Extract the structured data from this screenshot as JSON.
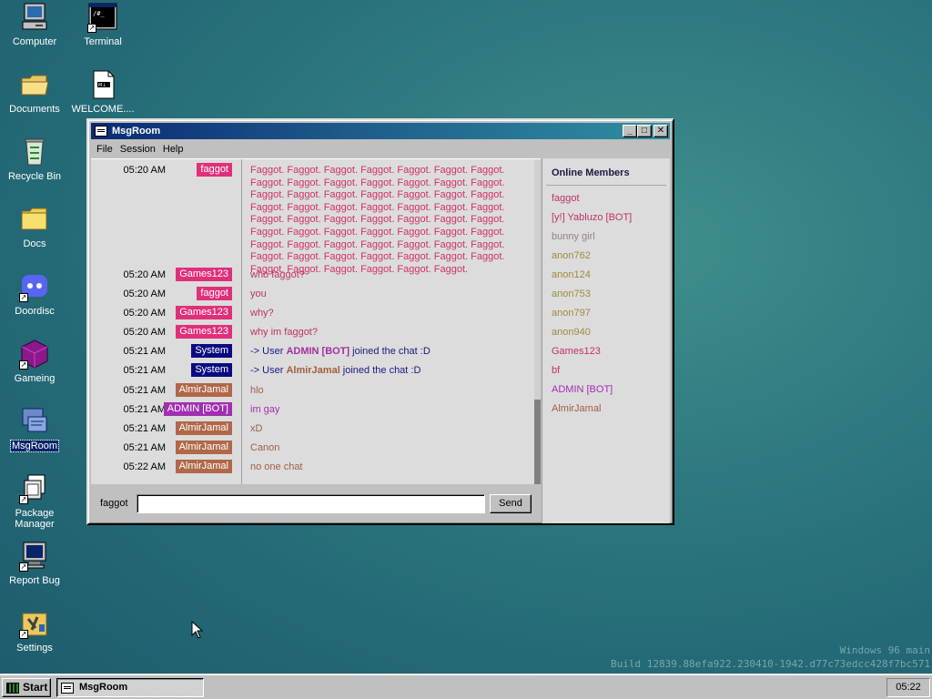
{
  "desktop": {
    "icons": [
      {
        "label": "Computer",
        "icon": "computer-icon"
      },
      {
        "label": "Terminal",
        "icon": "terminal-icon"
      },
      {
        "label": "Documents",
        "icon": "folder-open-icon"
      },
      {
        "label": "WELCOME....",
        "icon": "document-icon"
      },
      {
        "label": "Recycle Bin",
        "icon": "recycle-bin-icon"
      },
      {
        "label": "Docs",
        "icon": "folder-icon"
      },
      {
        "label": "Doordisc",
        "icon": "doordisc-icon"
      },
      {
        "label": "Gameing",
        "icon": "cube-icon"
      },
      {
        "label": "MsgRoom",
        "icon": "msgroom-icon"
      },
      {
        "label": "Package Manager",
        "icon": "package-icon"
      },
      {
        "label": "Report Bug",
        "icon": "monitor-icon"
      },
      {
        "label": "Settings",
        "icon": "settings-icon"
      }
    ],
    "watermark_line1": "Windows 96 main",
    "watermark_line2": "Build 12839.88efa922.230410-1942.d77c73edcc428f7bc571"
  },
  "window": {
    "title": "MsgRoom",
    "menu": [
      "File",
      "Session",
      "Help"
    ],
    "messages": [
      {
        "time": "05:20 AM",
        "nick": "faggot",
        "nick_color": "#e0307a",
        "text": "Faggot. Faggot. Faggot. Faggot. Faggot. Faggot. Faggot. Faggot. Faggot. Faggot. Faggot. Faggot. Faggot. Faggot. Faggot. Faggot. Faggot. Faggot. Faggot. Faggot. Faggot. Faggot. Faggot. Faggot. Faggot. Faggot. Faggot. Faggot. Faggot. Faggot. Faggot. Faggot. Faggot. Faggot. Faggot. Faggot. Faggot. Faggot. Faggot. Faggot. Faggot. Faggot. Faggot. Faggot. Faggot. Faggot. Faggot. Faggot. Faggot. Faggot. Faggot. Faggot. Faggot. Faggot. Faggot. Faggot. Faggot. Faggot. Faggot. Faggot. Faggot. Faggot.",
        "text_color": "#d0306a"
      },
      {
        "time": "05:20 AM",
        "nick": "Games123",
        "nick_color": "#e0307a",
        "text": "who faggot?",
        "text_color": "#c0306a"
      },
      {
        "time": "05:20 AM",
        "nick": "faggot",
        "nick_color": "#e0307a",
        "text": "you",
        "text_color": "#c0306a"
      },
      {
        "time": "05:20 AM",
        "nick": "Games123",
        "nick_color": "#e0307a",
        "text": "why?",
        "text_color": "#c0306a"
      },
      {
        "time": "05:20 AM",
        "nick": "Games123",
        "nick_color": "#e0307a",
        "text": "why im faggot?",
        "text_color": "#c0306a"
      },
      {
        "time": "05:21 AM",
        "nick": "System",
        "nick_color": "#0a0a80",
        "system": true,
        "prefix": "-> User ",
        "user": "ADMIN [BOT]",
        "user_color": "#a030a0",
        "suffix": " joined the chat :D",
        "text_color": "#1a1a80"
      },
      {
        "time": "05:21 AM",
        "nick": "System",
        "nick_color": "#0a0a80",
        "system": true,
        "prefix": "-> User ",
        "user": "AlmirJamal",
        "user_color": "#a06040",
        "suffix": " joined the chat :D",
        "text_color": "#1a1a80"
      },
      {
        "time": "05:21 AM",
        "nick": "AlmirJamal",
        "nick_color": "#b06848",
        "text": "hlo",
        "text_color": "#a06048"
      },
      {
        "time": "05:21 AM",
        "nick": "ADMIN [BOT]",
        "nick_color": "#a030b0",
        "text": "im gay",
        "text_color": "#a030b0"
      },
      {
        "time": "05:21 AM",
        "nick": "AlmirJamal",
        "nick_color": "#b06848",
        "text": "xD",
        "text_color": "#a06048"
      },
      {
        "time": "05:21 AM",
        "nick": "AlmirJamal",
        "nick_color": "#b06848",
        "text": "Canon",
        "text_color": "#a06048"
      },
      {
        "time": "05:22 AM",
        "nick": "AlmirJamal",
        "nick_color": "#b06848",
        "text": "no one chat",
        "text_color": "#a06048"
      }
    ],
    "input": {
      "nick_label": "faggot",
      "value": "",
      "send_label": "Send"
    },
    "members_title": "Online Members",
    "members": [
      {
        "name": "faggot",
        "color": "#c0306a"
      },
      {
        "name": "[y!] Yabluzo [BOT]",
        "color": "#c0306a"
      },
      {
        "name": "bunny girl",
        "color": "#9a8080"
      },
      {
        "name": "anon762",
        "color": "#a08a40"
      },
      {
        "name": "anon124",
        "color": "#a08a40"
      },
      {
        "name": "anon753",
        "color": "#a08a40"
      },
      {
        "name": "anon797",
        "color": "#a08a40"
      },
      {
        "name": "anon940",
        "color": "#a08a40"
      },
      {
        "name": "Games123",
        "color": "#c0306a"
      },
      {
        "name": "bf",
        "color": "#c0306a"
      },
      {
        "name": "ADMIN [BOT]",
        "color": "#a030b0"
      },
      {
        "name": "AlmirJamal",
        "color": "#a06040"
      }
    ]
  },
  "taskbar": {
    "start_label": "Start",
    "task_label": "MsgRoom",
    "clock": "05:22"
  }
}
